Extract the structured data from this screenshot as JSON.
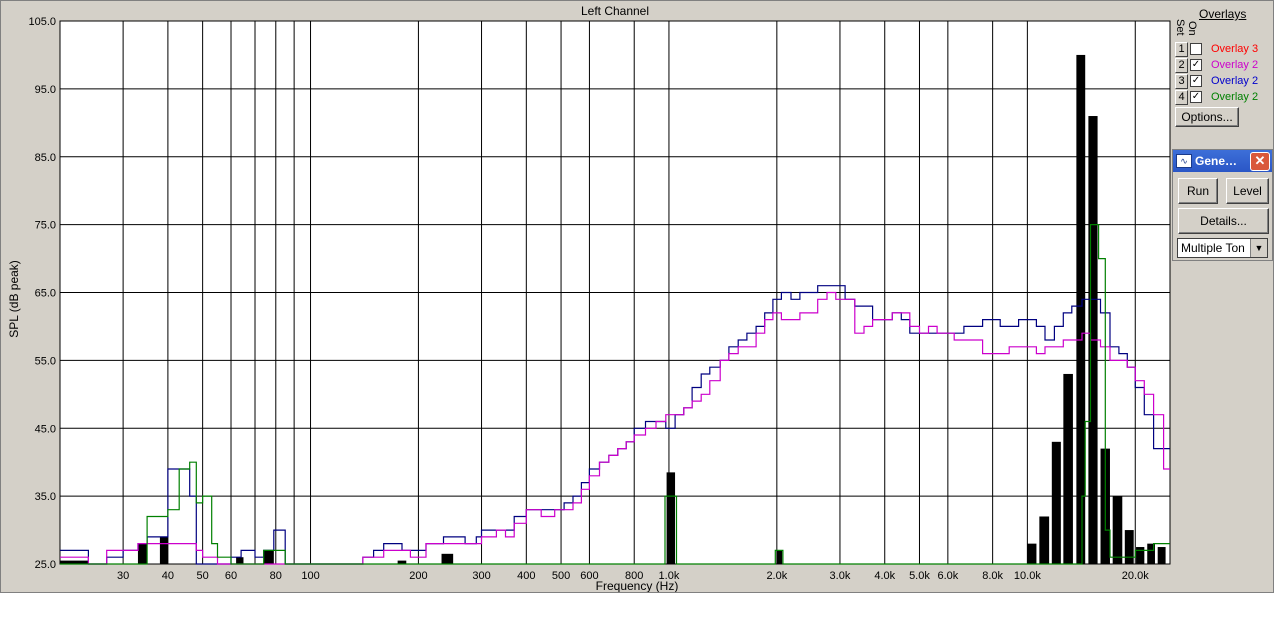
{
  "window": {
    "title": "Left Channel"
  },
  "chart_data": {
    "type": "line",
    "title": "Left Channel",
    "xlabel": "Frequency (Hz)",
    "ylabel": "SPL (dB peak)",
    "xscale": "log",
    "xlim": [
      20,
      25000
    ],
    "ylim": [
      25,
      105
    ],
    "grid": true,
    "y_ticks": [
      "25.0",
      "35.0",
      "45.0",
      "55.0",
      "65.0",
      "75.0",
      "85.0",
      "95.0",
      "105.0"
    ],
    "x_ticks": [
      {
        "value": 30,
        "label": "30"
      },
      {
        "value": 40,
        "label": "40"
      },
      {
        "value": 50,
        "label": "50"
      },
      {
        "value": 60,
        "label": "60"
      },
      {
        "value": 80,
        "label": "80"
      },
      {
        "value": 100,
        "label": "100"
      },
      {
        "value": 200,
        "label": "200"
      },
      {
        "value": 300,
        "label": "300"
      },
      {
        "value": 400,
        "label": "400"
      },
      {
        "value": 500,
        "label": "500"
      },
      {
        "value": 600,
        "label": "600"
      },
      {
        "value": 800,
        "label": "800"
      },
      {
        "value": 1000,
        "label": "1.0k"
      },
      {
        "value": 2000,
        "label": "2.0k"
      },
      {
        "value": 3000,
        "label": "3.0k"
      },
      {
        "value": 4000,
        "label": "4.0k"
      },
      {
        "value": 5000,
        "label": "5.0k"
      },
      {
        "value": 6000,
        "label": "6.0k"
      },
      {
        "value": 8000,
        "label": "8.0k"
      },
      {
        "value": 10000,
        "label": "10.0k"
      },
      {
        "value": 20000,
        "label": "20.0k"
      }
    ],
    "minor_gridlines": [
      70,
      90
    ],
    "series": [
      {
        "name": "Overlay 2",
        "color": "#000080",
        "style": "step",
        "points": [
          [
            20,
            27
          ],
          [
            24,
            25
          ],
          [
            27,
            26
          ],
          [
            30,
            27
          ],
          [
            33,
            28
          ],
          [
            35,
            29
          ],
          [
            38,
            29
          ],
          [
            40,
            39
          ],
          [
            43,
            39
          ],
          [
            46,
            35
          ],
          [
            48,
            25
          ],
          [
            50,
            25
          ],
          [
            55,
            25
          ],
          [
            60,
            26
          ],
          [
            64,
            27
          ],
          [
            70,
            26
          ],
          [
            74,
            27
          ],
          [
            79,
            30
          ],
          [
            85,
            25
          ],
          [
            100,
            25
          ],
          [
            125,
            25
          ],
          [
            140,
            26
          ],
          [
            150,
            27
          ],
          [
            160,
            28
          ],
          [
            170,
            28
          ],
          [
            180,
            27
          ],
          [
            200,
            27
          ],
          [
            210,
            28
          ],
          [
            220,
            28
          ],
          [
            235,
            29
          ],
          [
            250,
            29
          ],
          [
            270,
            28
          ],
          [
            290,
            29
          ],
          [
            300,
            30
          ],
          [
            330,
            30
          ],
          [
            350,
            30
          ],
          [
            370,
            32
          ],
          [
            400,
            33
          ],
          [
            440,
            33
          ],
          [
            480,
            33
          ],
          [
            510,
            34
          ],
          [
            540,
            35
          ],
          [
            570,
            37
          ],
          [
            600,
            39
          ],
          [
            640,
            40
          ],
          [
            680,
            41
          ],
          [
            720,
            42
          ],
          [
            760,
            43
          ],
          [
            800,
            45
          ],
          [
            860,
            46
          ],
          [
            920,
            46
          ],
          [
            980,
            45
          ],
          [
            1040,
            47
          ],
          [
            1100,
            48
          ],
          [
            1160,
            51
          ],
          [
            1230,
            53
          ],
          [
            1300,
            54
          ],
          [
            1390,
            55
          ],
          [
            1470,
            57
          ],
          [
            1560,
            58
          ],
          [
            1650,
            59
          ],
          [
            1750,
            60
          ],
          [
            1850,
            62
          ],
          [
            1950,
            64
          ],
          [
            2060,
            65
          ],
          [
            2190,
            64
          ],
          [
            2320,
            65
          ],
          [
            2460,
            65
          ],
          [
            2600,
            66
          ],
          [
            2760,
            66
          ],
          [
            2920,
            66
          ],
          [
            3100,
            64
          ],
          [
            3300,
            63
          ],
          [
            3500,
            63
          ],
          [
            3700,
            61
          ],
          [
            3950,
            61
          ],
          [
            4200,
            62
          ],
          [
            4450,
            61
          ],
          [
            4700,
            59
          ],
          [
            5000,
            59
          ],
          [
            5300,
            59
          ],
          [
            5600,
            59
          ],
          [
            5900,
            59
          ],
          [
            6250,
            59
          ],
          [
            6650,
            60
          ],
          [
            7050,
            60
          ],
          [
            7500,
            61
          ],
          [
            7950,
            61
          ],
          [
            8400,
            60
          ],
          [
            8900,
            60
          ],
          [
            9450,
            61
          ],
          [
            10000,
            61
          ],
          [
            10600,
            60
          ],
          [
            11200,
            58
          ],
          [
            11900,
            60
          ],
          [
            12600,
            62
          ],
          [
            13300,
            63
          ],
          [
            14200,
            64
          ],
          [
            15000,
            64
          ],
          [
            16000,
            62
          ],
          [
            17000,
            57
          ],
          [
            18000,
            56
          ],
          [
            19000,
            54
          ],
          [
            20000,
            51
          ],
          [
            21200,
            47
          ],
          [
            22500,
            42
          ],
          [
            24000,
            42
          ],
          [
            25000,
            42
          ]
        ]
      },
      {
        "name": "Overlay 2",
        "color": "#cc00cc",
        "style": "step",
        "points": [
          [
            20,
            26
          ],
          [
            24,
            25
          ],
          [
            27,
            27
          ],
          [
            30,
            27
          ],
          [
            33,
            28
          ],
          [
            36,
            28
          ],
          [
            39,
            28
          ],
          [
            41,
            28
          ],
          [
            44,
            28
          ],
          [
            46,
            28
          ],
          [
            48,
            27
          ],
          [
            50,
            26
          ],
          [
            55,
            25
          ],
          [
            100,
            25
          ],
          [
            140,
            26
          ],
          [
            150,
            26
          ],
          [
            160,
            27
          ],
          [
            170,
            27
          ],
          [
            180,
            27
          ],
          [
            190,
            26
          ],
          [
            200,
            26
          ],
          [
            210,
            28
          ],
          [
            230,
            28
          ],
          [
            250,
            28
          ],
          [
            270,
            28
          ],
          [
            290,
            28
          ],
          [
            300,
            29
          ],
          [
            330,
            30
          ],
          [
            350,
            29
          ],
          [
            370,
            31
          ],
          [
            400,
            33
          ],
          [
            440,
            32
          ],
          [
            480,
            33
          ],
          [
            510,
            33
          ],
          [
            540,
            34
          ],
          [
            570,
            36
          ],
          [
            600,
            38
          ],
          [
            640,
            40
          ],
          [
            680,
            41
          ],
          [
            720,
            42
          ],
          [
            760,
            43
          ],
          [
            800,
            44
          ],
          [
            860,
            45
          ],
          [
            920,
            46
          ],
          [
            980,
            47
          ],
          [
            1040,
            47
          ],
          [
            1100,
            48
          ],
          [
            1160,
            49
          ],
          [
            1230,
            50
          ],
          [
            1300,
            52
          ],
          [
            1390,
            55
          ],
          [
            1470,
            56
          ],
          [
            1560,
            57
          ],
          [
            1650,
            57
          ],
          [
            1750,
            59
          ],
          [
            1850,
            61
          ],
          [
            1950,
            62
          ],
          [
            2060,
            61
          ],
          [
            2190,
            61
          ],
          [
            2320,
            62
          ],
          [
            2460,
            62
          ],
          [
            2600,
            64
          ],
          [
            2760,
            65
          ],
          [
            2920,
            64
          ],
          [
            3100,
            64
          ],
          [
            3300,
            59
          ],
          [
            3500,
            60
          ],
          [
            3700,
            61
          ],
          [
            3950,
            61
          ],
          [
            4200,
            62
          ],
          [
            4450,
            62
          ],
          [
            4700,
            60
          ],
          [
            5000,
            59
          ],
          [
            5300,
            60
          ],
          [
            5600,
            59
          ],
          [
            5900,
            59
          ],
          [
            6250,
            58
          ],
          [
            6650,
            58
          ],
          [
            7050,
            58
          ],
          [
            7500,
            56
          ],
          [
            7950,
            56
          ],
          [
            8400,
            56
          ],
          [
            8900,
            57
          ],
          [
            9450,
            57
          ],
          [
            10000,
            57
          ],
          [
            10600,
            56
          ],
          [
            11200,
            57
          ],
          [
            11900,
            57
          ],
          [
            12600,
            58
          ],
          [
            13300,
            58
          ],
          [
            14200,
            59
          ],
          [
            15000,
            58
          ],
          [
            16000,
            57
          ],
          [
            17000,
            55
          ],
          [
            18000,
            55
          ],
          [
            19000,
            54
          ],
          [
            20000,
            52
          ],
          [
            21200,
            50
          ],
          [
            22500,
            47
          ],
          [
            24000,
            39
          ],
          [
            25000,
            39
          ]
        ]
      },
      {
        "name": "Overlay 2",
        "color": "#008000",
        "style": "step",
        "points": [
          [
            20,
            25
          ],
          [
            34,
            25
          ],
          [
            35,
            32
          ],
          [
            38,
            32
          ],
          [
            40,
            33
          ],
          [
            43,
            39
          ],
          [
            46,
            40
          ],
          [
            48,
            34
          ],
          [
            50,
            35
          ],
          [
            53,
            28
          ],
          [
            55,
            26
          ],
          [
            60,
            25
          ],
          [
            72,
            25
          ],
          [
            74,
            27
          ],
          [
            79,
            27
          ],
          [
            85,
            25
          ],
          [
            960,
            25
          ],
          [
            975,
            35
          ],
          [
            1040,
            35
          ],
          [
            1050,
            25
          ],
          [
            1960,
            25
          ],
          [
            1980,
            27
          ],
          [
            2060,
            27
          ],
          [
            2080,
            25
          ],
          [
            14000,
            25
          ],
          [
            14200,
            35
          ],
          [
            14500,
            46
          ],
          [
            15000,
            75
          ],
          [
            15800,
            70
          ],
          [
            16500,
            30
          ],
          [
            17000,
            26
          ],
          [
            18000,
            26
          ],
          [
            19000,
            26
          ],
          [
            20000,
            27
          ],
          [
            21200,
            27
          ],
          [
            22500,
            28
          ],
          [
            24000,
            28
          ],
          [
            25000,
            28
          ]
        ]
      }
    ],
    "bars": [
      {
        "x1": 20,
        "x2": 24,
        "value": 25.5
      },
      {
        "x1": 33,
        "x2": 35,
        "value": 28
      },
      {
        "x1": 38,
        "x2": 40,
        "value": 29
      },
      {
        "x1": 62,
        "x2": 65,
        "value": 26
      },
      {
        "x1": 74,
        "x2": 79,
        "value": 27
      },
      {
        "x1": 175,
        "x2": 185,
        "value": 25.5
      },
      {
        "x1": 232,
        "x2": 250,
        "value": 26.5
      },
      {
        "x1": 985,
        "x2": 1040,
        "value": 38.5
      },
      {
        "x1": 2000,
        "x2": 2070,
        "value": 27
      },
      {
        "x1": 10000,
        "x2": 10600,
        "value": 28
      },
      {
        "x1": 10800,
        "x2": 11500,
        "value": 32
      },
      {
        "x1": 11700,
        "x2": 12400,
        "value": 43
      },
      {
        "x1": 12600,
        "x2": 13400,
        "value": 53
      },
      {
        "x1": 13700,
        "x2": 14500,
        "value": 100
      },
      {
        "x1": 14800,
        "x2": 15700,
        "value": 91
      },
      {
        "x1": 16000,
        "x2": 17000,
        "value": 42
      },
      {
        "x1": 17300,
        "x2": 18400,
        "value": 35
      },
      {
        "x1": 18700,
        "x2": 19800,
        "value": 30
      },
      {
        "x1": 20100,
        "x2": 21200,
        "value": 27.5
      },
      {
        "x1": 21600,
        "x2": 22700,
        "value": 28
      },
      {
        "x1": 23100,
        "x2": 24300,
        "value": 27.5
      }
    ]
  },
  "overlays_panel": {
    "title": "Overlays",
    "set_header": "Set",
    "on_header": "On",
    "items": [
      {
        "num": "1",
        "checked": false,
        "check_mark": "",
        "label": "Overlay 3",
        "color": "#ff0000"
      },
      {
        "num": "2",
        "checked": true,
        "check_mark": "✓",
        "label": "Overlay 2",
        "color": "#cc00cc"
      },
      {
        "num": "3",
        "checked": true,
        "check_mark": "✓",
        "label": "Overlay 2",
        "color": "#0000cc"
      },
      {
        "num": "4",
        "checked": true,
        "check_mark": "✓",
        "label": "Overlay 2",
        "color": "#008000"
      }
    ],
    "options_label": "Options..."
  },
  "generator_panel": {
    "title": "Gene…",
    "icon": "waveform-icon",
    "close_glyph": "✕",
    "run_label": "Run",
    "level_label": "Level",
    "details_label": "Details...",
    "mode_value": "Multiple Ton",
    "dropdown_arrow": "▼"
  }
}
